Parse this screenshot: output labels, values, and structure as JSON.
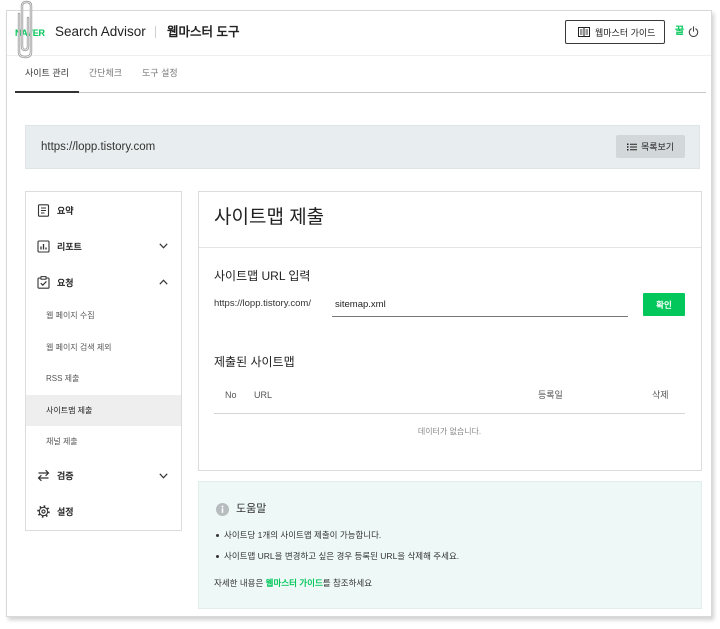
{
  "colors": {
    "brand_green": "#03c75a",
    "help_background": "#eef8f6",
    "site_bar_background": "#e8edef",
    "active_item_background": "#eeeeee"
  },
  "decoration_icon": "paper-clip-icon",
  "header": {
    "logo": "NAVER",
    "app_name": "Search Advisor",
    "tool_name": "웹마스터 도구",
    "guide_button": {
      "label": "웹마스터 가이드",
      "icon": "book-icon"
    },
    "user_badge": "꿀",
    "logout_icon": "power-icon"
  },
  "tabs": {
    "active_index": 0,
    "items": [
      {
        "label": "사이트 관리"
      },
      {
        "label": "간단체크"
      },
      {
        "label": "도구 설정"
      }
    ]
  },
  "site_bar": {
    "url": "https://lopp.tistory.com",
    "list_button": {
      "label": "목록보기",
      "icon": "list-icon"
    }
  },
  "sidebar": {
    "items": [
      {
        "label": "요약",
        "icon": "document-icon"
      },
      {
        "label": "리포트",
        "icon": "chart-icon",
        "chevron_icon": "chevron-down-icon"
      },
      {
        "label": "요청",
        "icon": "checklist-icon",
        "chevron_icon": "chevron-up-icon",
        "expanded": true
      },
      {
        "label": "검증",
        "icon": "arrows-icon",
        "chevron_icon": "chevron-down-icon"
      },
      {
        "label": "설정",
        "icon": "gear-icon"
      }
    ],
    "request_sub_items": [
      {
        "label": "웹 페이지 수집"
      },
      {
        "label": "웹 페이지 검색 제외"
      },
      {
        "label": "RSS 제출"
      },
      {
        "label": "사이트맵 제출"
      },
      {
        "label": "채널 제출"
      }
    ],
    "active_sub_index": 3
  },
  "main": {
    "title": "사이트맵 제출",
    "url_section": {
      "title": "사이트맵 URL 입력",
      "prefix": "https://lopp.tistory.com/",
      "input_value": "sitemap.xml",
      "confirm_button": "확인"
    },
    "submitted_section": {
      "title": "제출된 사이트맵",
      "columns": [
        "No",
        "URL",
        "등록일",
        "삭제"
      ],
      "rows": [],
      "empty_text": "데이터가 없습니다."
    }
  },
  "help": {
    "icon": "info-icon",
    "title": "도움말",
    "bullets": [
      "사이트당 1개의 사이트맵 제출이 가능합니다.",
      "사이트맵 URL을 변경하고 싶은 경우 등록된 URL을 삭제해 주세요."
    ],
    "footer": {
      "prefix": "자세한 내용은 ",
      "link": "웹마스터 가이드",
      "suffix": "를 참조하세요"
    }
  }
}
